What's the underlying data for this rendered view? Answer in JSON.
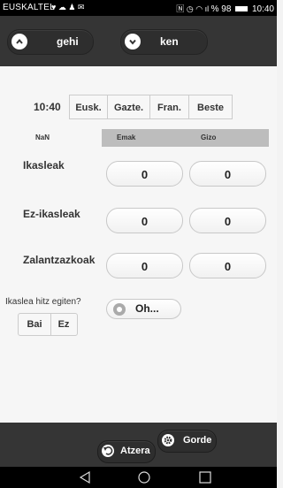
{
  "status": {
    "carrier": "EUSKALTEL",
    "right": "% 98",
    "time": "10:40"
  },
  "nav": {
    "prev_label": "gehi",
    "next_label": "ken"
  },
  "toolbar": {
    "time": "10:40",
    "lang_buttons": [
      "Eusk.",
      "Gazte.",
      "Fran.",
      "Beste"
    ]
  },
  "table": {
    "headers": [
      "NaN",
      "Emak",
      "Gizo"
    ]
  },
  "rows": [
    {
      "label": "Ikasleak",
      "emak": "0",
      "gizo": "0"
    },
    {
      "label": "Ez-ikasleak",
      "emak": "0",
      "gizo": "0"
    },
    {
      "label": "Zalantzazkoak",
      "emak": "0",
      "gizo": "0"
    }
  ],
  "question": {
    "text": "Ikaslea hitz egiten?",
    "yes": "Bai",
    "no": "Ez",
    "select_label": "Oh..."
  },
  "bottom": {
    "back_label": "Atzera",
    "save_label": "Gorde"
  }
}
